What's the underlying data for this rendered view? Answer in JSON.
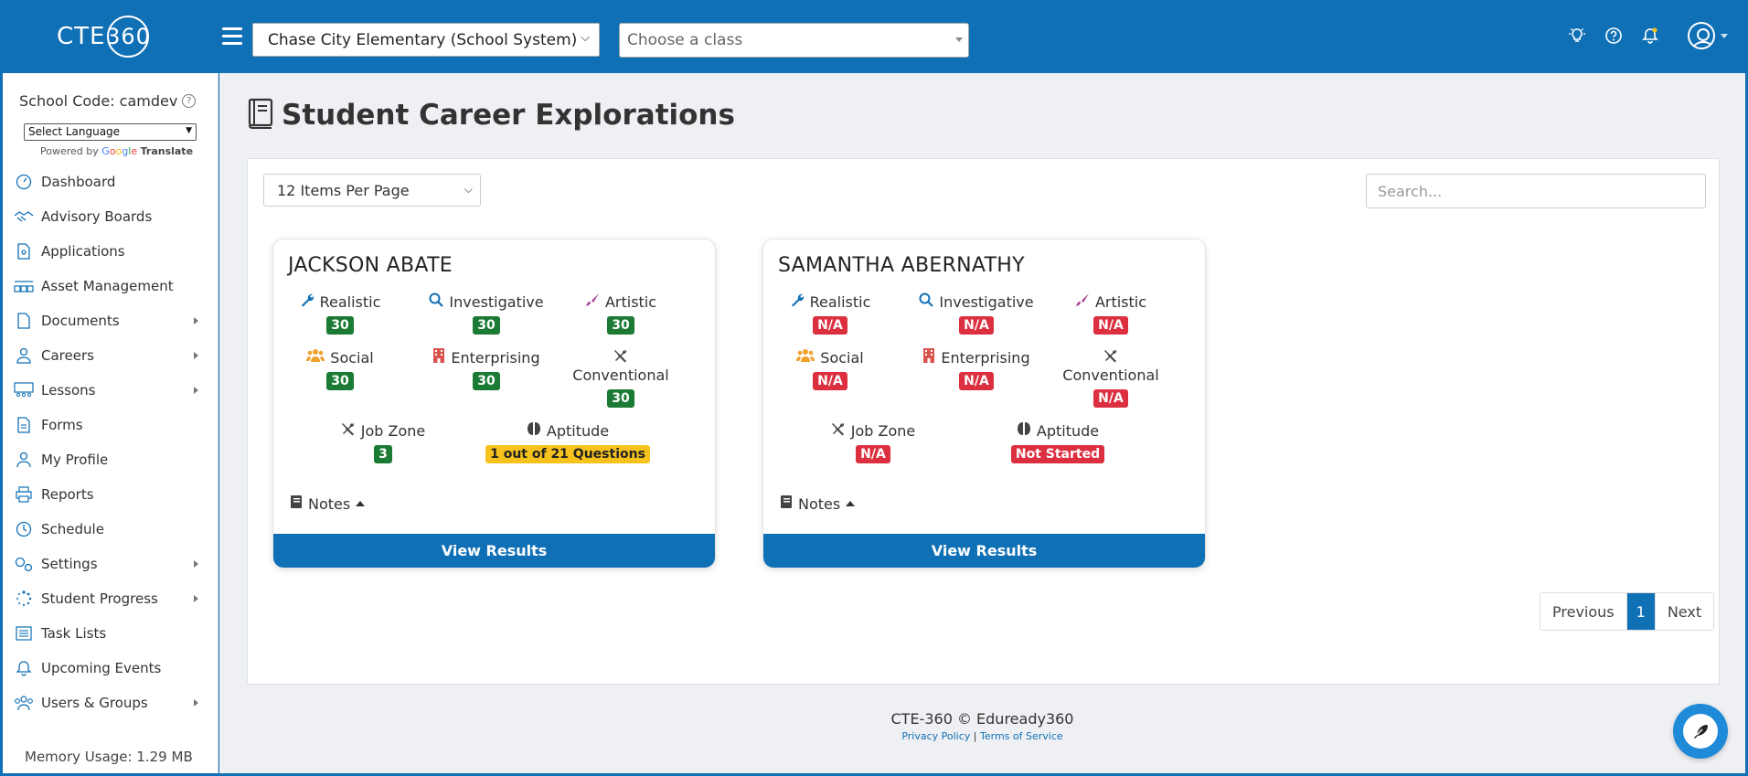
{
  "header": {
    "logo_text": "CTE",
    "logo_ring": "360",
    "school_select_value": "Chase City Elementary (School System)",
    "class_select_placeholder": "Choose a class",
    "icons": [
      "lightbulb-icon",
      "help-icon",
      "bell-icon",
      "user-avatar-icon"
    ]
  },
  "sidebar": {
    "school_code": "School Code: camdev",
    "language_select": "Select Language",
    "powered_by": "Powered by",
    "google": [
      "G",
      "o",
      "o",
      "g",
      "l",
      "e"
    ],
    "translate": "Translate",
    "items": [
      {
        "label": "Dashboard",
        "icon": "gauge-icon",
        "submenu": false
      },
      {
        "label": "Advisory Boards",
        "icon": "handshake-icon",
        "submenu": false
      },
      {
        "label": "Applications",
        "icon": "file-icon",
        "submenu": false
      },
      {
        "label": "Asset Management",
        "icon": "boxes-icon",
        "submenu": false
      },
      {
        "label": "Documents",
        "icon": "document-icon",
        "submenu": true
      },
      {
        "label": "Careers",
        "icon": "user-tie-icon",
        "submenu": true
      },
      {
        "label": "Lessons",
        "icon": "classroom-icon",
        "submenu": true
      },
      {
        "label": "Forms",
        "icon": "form-icon",
        "submenu": false
      },
      {
        "label": "My Profile",
        "icon": "user-icon",
        "submenu": false
      },
      {
        "label": "Reports",
        "icon": "printer-icon",
        "submenu": false
      },
      {
        "label": "Schedule",
        "icon": "clock-icon",
        "submenu": false
      },
      {
        "label": "Settings",
        "icon": "gears-icon",
        "submenu": true
      },
      {
        "label": "Student Progress",
        "icon": "spinner-icon",
        "submenu": true
      },
      {
        "label": "Task Lists",
        "icon": "list-icon",
        "submenu": false
      },
      {
        "label": "Upcoming Events",
        "icon": "bell-icon",
        "submenu": false
      },
      {
        "label": "Users & Groups",
        "icon": "users-icon",
        "submenu": true
      }
    ],
    "memory": "Memory Usage: 1.29 MB"
  },
  "main": {
    "title": "Student Career Explorations",
    "per_page": "12 Items Per Page",
    "search_placeholder": "Search...",
    "cards": [
      {
        "name": "JACKSON ABATE",
        "realistic": "Realistic",
        "realistic_val": "30",
        "investigative": "Investigative",
        "investigative_val": "30",
        "artistic": "Artistic",
        "artistic_val": "30",
        "social": "Social",
        "social_val": "30",
        "enterprising": "Enterprising",
        "enterprising_val": "30",
        "conventional": "Conventional",
        "conventional_val": "30",
        "job_zone": "Job Zone",
        "job_zone_val": "3",
        "aptitude": "Aptitude",
        "aptitude_val": "1 out of 21 Questions",
        "notes": "Notes",
        "button": "View Results"
      },
      {
        "name": "SAMANTHA ABERNATHY",
        "realistic": "Realistic",
        "realistic_val": "N/A",
        "investigative": "Investigative",
        "investigative_val": "N/A",
        "artistic": "Artistic",
        "artistic_val": "N/A",
        "social": "Social",
        "social_val": "N/A",
        "enterprising": "Enterprising",
        "enterprising_val": "N/A",
        "conventional": "Conventional",
        "conventional_val": "N/A",
        "job_zone": "Job Zone",
        "job_zone_val": "N/A",
        "aptitude": "Aptitude",
        "aptitude_val": "Not Started",
        "notes": "Notes",
        "button": "View Results"
      }
    ],
    "pagination": {
      "prev": "Previous",
      "page": "1",
      "next": "Next"
    }
  },
  "footer": {
    "copyright": "CTE-360 © Eduready360",
    "privacy": "Privacy Policy",
    "separator": "|",
    "terms": "Terms of Service"
  },
  "colors": {
    "brand": "#1070b6",
    "badge_green": "#1b7a33",
    "badge_red": "#dc2f3f",
    "badge_yellow": "#f7c21d"
  }
}
